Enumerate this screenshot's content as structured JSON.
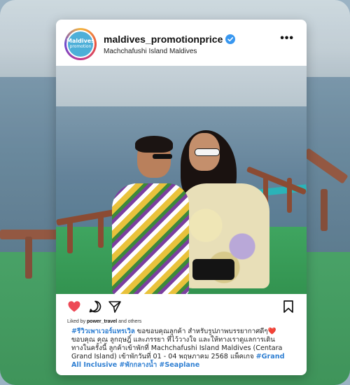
{
  "post": {
    "username": "maldives_promotionprice",
    "location": "Machchafushi Island Maldives",
    "avatar_line1": "Maldives",
    "avatar_line2": "promotion",
    "more_icon": "•••",
    "liked_by_prefix": "Liked by ",
    "liked_by_user": "power_travel",
    "liked_by_suffix": " and others",
    "caption_tag1": "#รีวิวเพาเวอร์แทรเวิล",
    "caption_text1": " ขอขอบคุณลูกค้า สำหรับรูปภาพบรรยากาศดีๆ❤️ ขอบคุณ คุณ ลูกฤษฎิ์ และภรรยา ที่ไว้วางใจ และให้ทางเราดูแลการเดินทางในครั้งนี้ ลูกค้าเข้าพักที่ Machchafushi Island Maldives (Centara Grand Island) เข้าพักวันที่ 01 - 04 พฤษภาคม 2568 แพ็คเกจ ",
    "caption_tag2": "#Grand All Inclusive",
    "caption_tag3": "#พักกลางน้ำ",
    "caption_tag4": "#Seaplane"
  },
  "colors": {
    "verified": "#3897f0",
    "hashtag": "#2f7fd2",
    "heart": "#ed4956"
  },
  "icons": [
    "verified-icon",
    "more-icon",
    "heart-icon",
    "comment-icon",
    "share-icon",
    "bookmark-icon"
  ]
}
